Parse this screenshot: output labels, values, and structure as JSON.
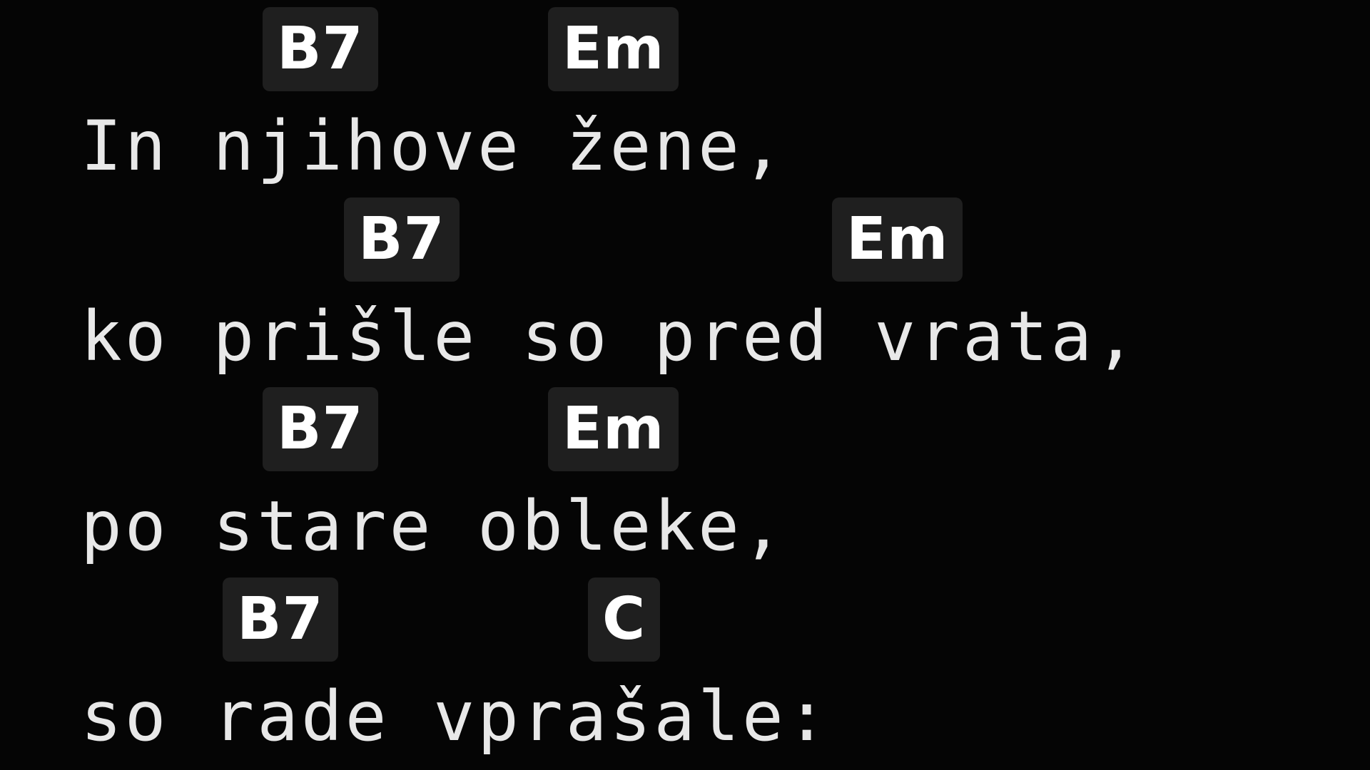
{
  "lines": [
    {
      "chords": [
        {
          "name": "B7"
        },
        {
          "name": "Em"
        }
      ],
      "lyric": "In njihove žene,"
    },
    {
      "chords": [
        {
          "name": "B7"
        },
        {
          "name": "Em"
        }
      ],
      "lyric": "ko prišle so pred vrata,"
    },
    {
      "chords": [
        {
          "name": "B7"
        },
        {
          "name": "Em"
        }
      ],
      "lyric": "po stare obleke,"
    },
    {
      "chords": [
        {
          "name": "B7"
        },
        {
          "name": "C"
        }
      ],
      "lyric": "so rade vprašale:"
    }
  ]
}
